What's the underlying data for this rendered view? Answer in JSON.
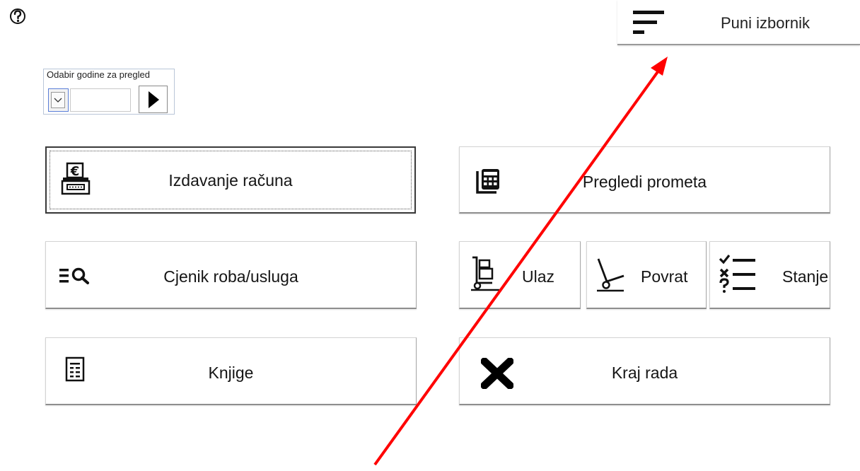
{
  "header": {
    "help_icon": "help-circle-icon",
    "menu_button": {
      "label": "Puni izbornik",
      "icon": "menu-lines-icon"
    }
  },
  "year_selector": {
    "caption": "Odabir godine za pregled",
    "value": "",
    "dropdown_icon": "chevron-down-icon",
    "go_icon": "play-triangle-icon"
  },
  "tiles": {
    "izdavanje": {
      "label": "Izdavanje računa",
      "icon": "cash-register-euro-icon"
    },
    "pregledi": {
      "label": "Pregledi prometa",
      "icon": "calculator-stack-icon"
    },
    "cjenik": {
      "label": "Cjenik roba/usluga",
      "icon": "list-search-icon"
    },
    "ulaz": {
      "label": "Ulaz",
      "icon": "hand-truck-boxes-icon"
    },
    "povrat": {
      "label": "Povrat",
      "icon": "hand-truck-empty-icon"
    },
    "stanje": {
      "label": "Stanje",
      "icon": "checklist-icon"
    },
    "knjige": {
      "label": "Knjige",
      "icon": "document-list-icon"
    },
    "kraj": {
      "label": "Kraj rada",
      "icon": "close-x-icon"
    }
  },
  "colors": {
    "annotation_arrow": "#ff0000",
    "dropdown_border": "#5a7ed8"
  }
}
